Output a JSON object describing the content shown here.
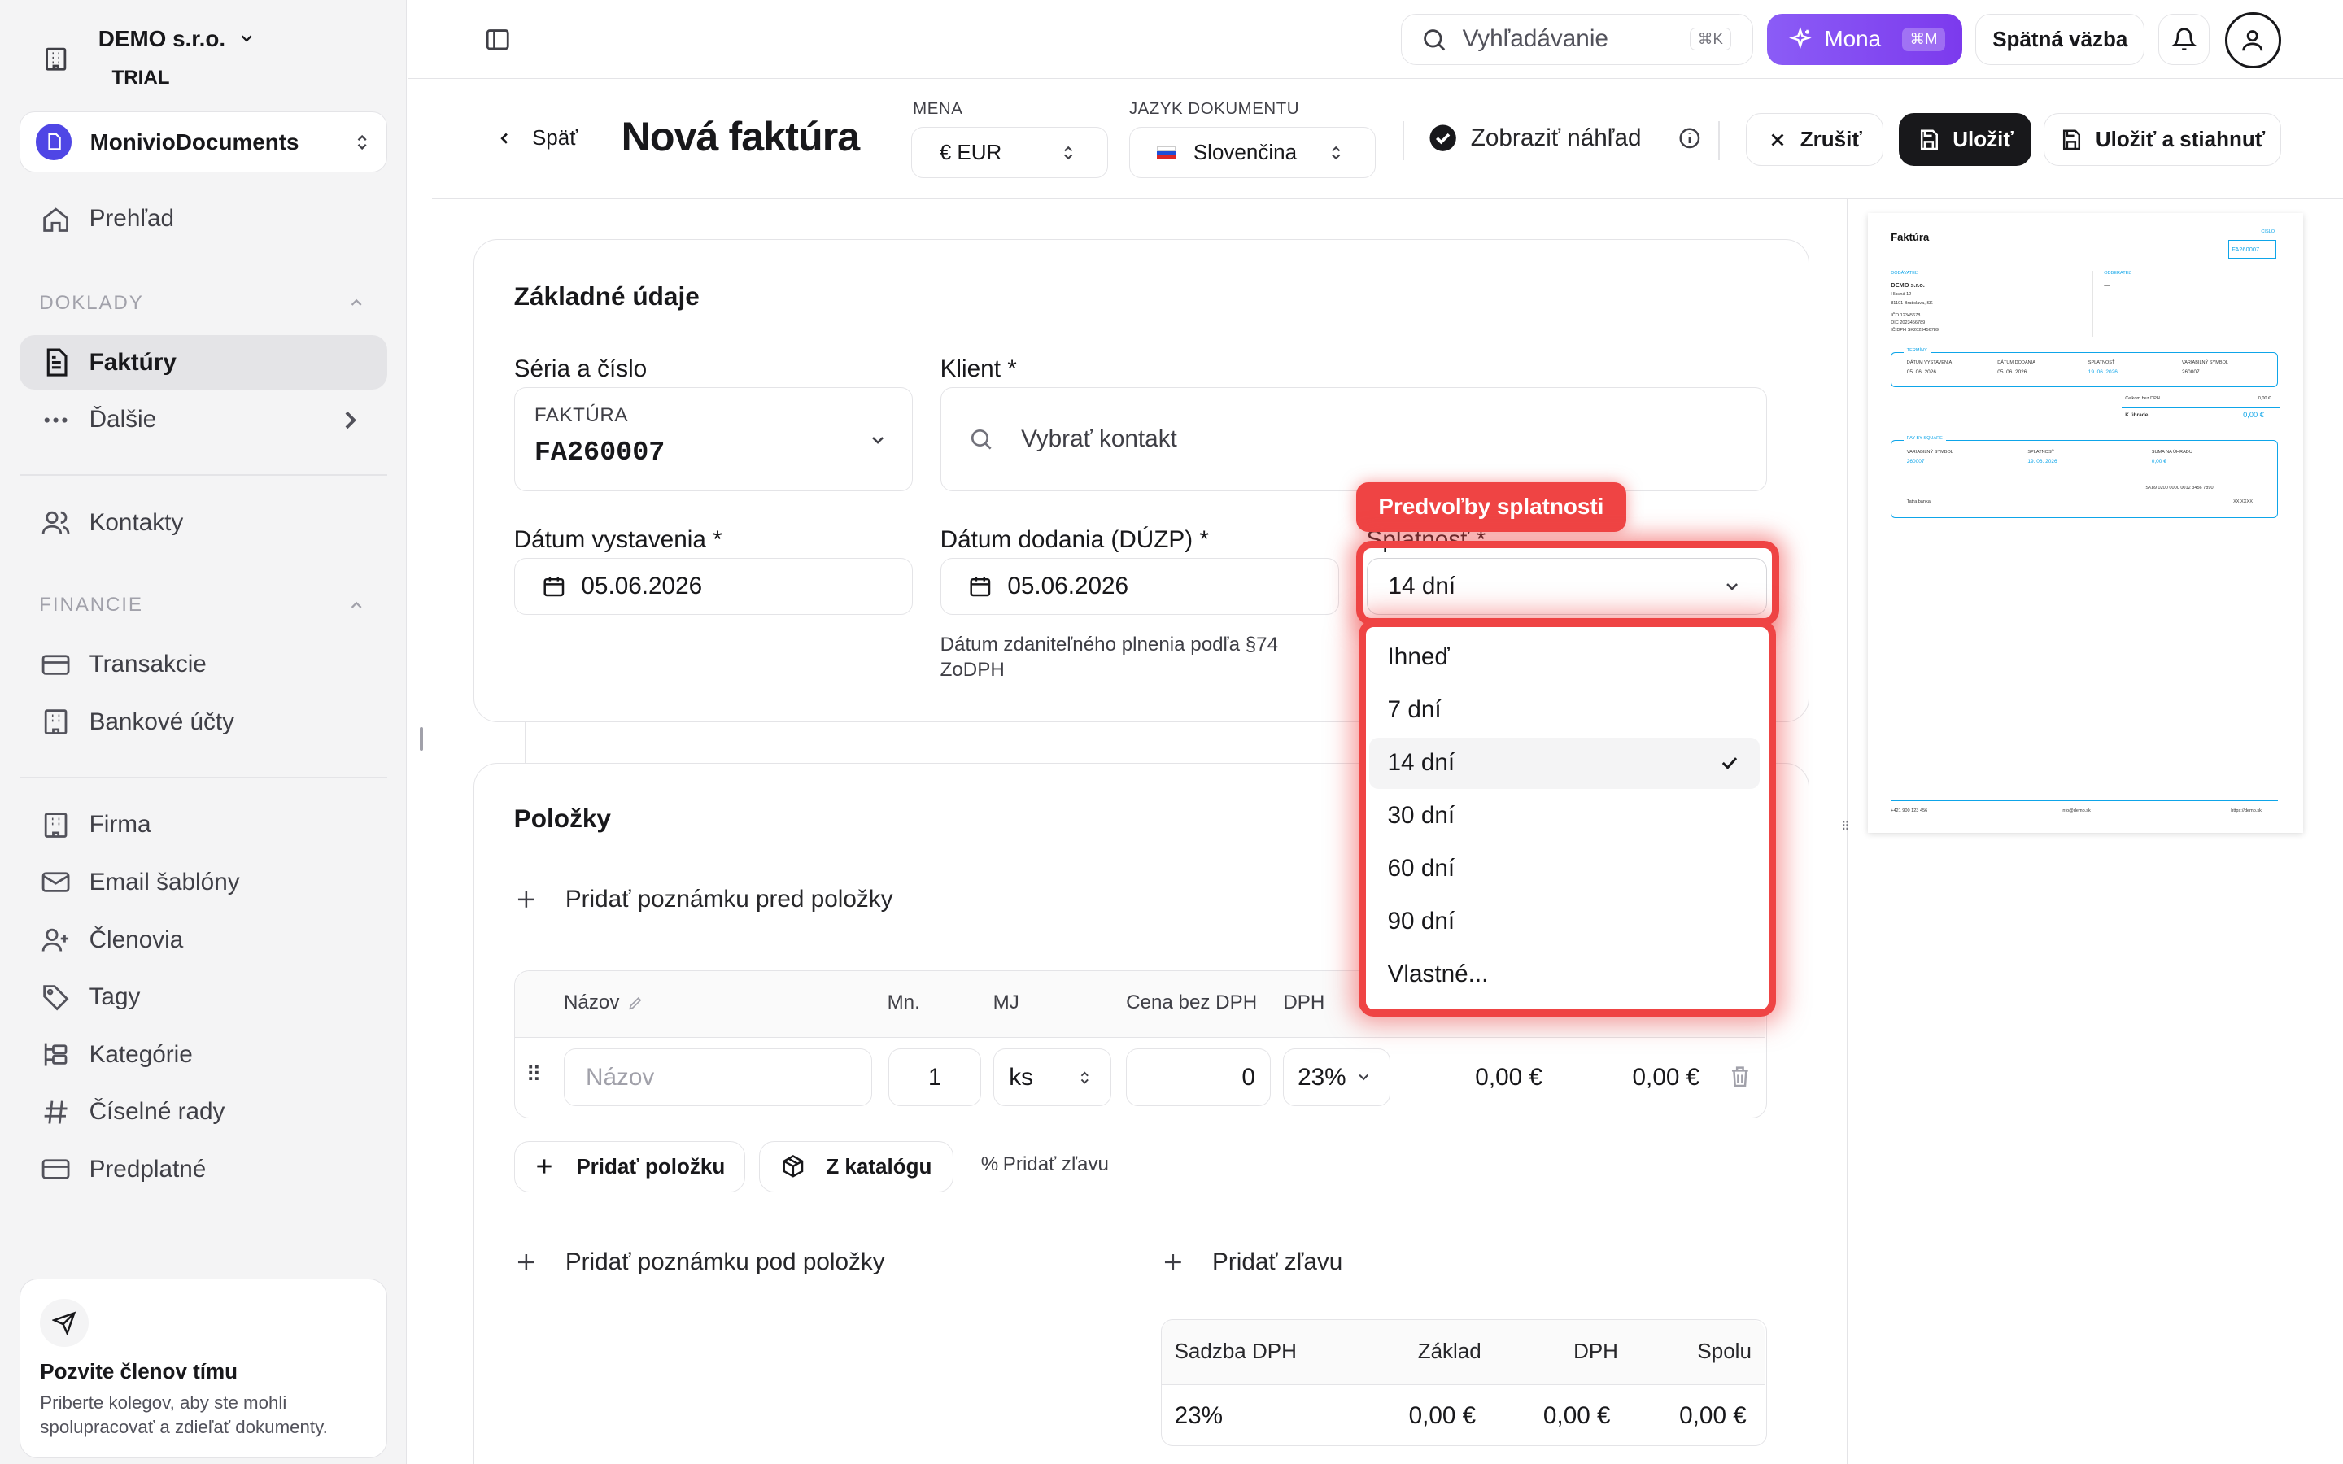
{
  "org": {
    "name": "DEMO s.r.o.",
    "plan": "TRIAL"
  },
  "workspace": {
    "name": "MonivioDocuments"
  },
  "sidebar": {
    "overview": "Prehľad",
    "section_documents": "DOKLADY",
    "invoices": "Faktúry",
    "more": "Ďalšie",
    "contacts": "Kontakty",
    "section_finance": "FINANCIE",
    "transactions": "Transakcie",
    "bank_accounts": "Bankové účty",
    "company": "Firma",
    "email_templates": "Email šablóny",
    "members": "Členovia",
    "tags": "Tagy",
    "categories": "Kategórie",
    "number_series": "Číselné rady",
    "subscription": "Predplatné",
    "invite": {
      "title": "Pozvite členov tímu",
      "text": "Priberte kolegov, aby ste mohli spolupracovať a zdieľať dokumenty."
    }
  },
  "topbar": {
    "search_placeholder": "Vyhľadávanie",
    "search_shortcut": "⌘K",
    "mona_label": "Mona",
    "mona_shortcut": "⌘M",
    "feedback_label": "Spätná väzba"
  },
  "header": {
    "back_label": "Späť",
    "title": "Nová faktúra",
    "currency_label": "MENA",
    "currency_value": "€ EUR",
    "language_label": "JAZYK DOKUMENTU",
    "language_value": "Slovenčina",
    "preview_toggle_label": "Zobraziť náhľad",
    "cancel_label": "Zrušiť",
    "save_label": "Uložiť",
    "save_download_label": "Uložiť a stiahnuť"
  },
  "basic": {
    "title": "Základné údaje",
    "series_label": "Séria a číslo",
    "series_prefix": "FAKTÚRA",
    "series_number": "FA260007",
    "client_label": "Klient *",
    "client_placeholder": "Vybrať kontakt",
    "issue_label": "Dátum vystavenia *",
    "issue_value": "05.06.2026",
    "delivery_label": "Dátum dodania (DÚZP) *",
    "delivery_value": "05.06.2026",
    "delivery_hint": "Dátum zdaniteľného plnenia podľa §74 ZoDPH",
    "due_label": "Splatnosť *",
    "due_value": "14 dní"
  },
  "dropdown": {
    "tooltip": "Predvoľby splatnosti",
    "options": [
      "Ihneď",
      "7 dní",
      "14 dní",
      "30 dní",
      "60 dní",
      "90 dní",
      "Vlastné..."
    ],
    "selected": "14 dní"
  },
  "items": {
    "title": "Položky",
    "add_note_before": "Pridať poznámku pred položky",
    "col_name": "Názov",
    "col_qty": "Mn.",
    "col_unit": "MJ",
    "col_price": "Cena bez DPH",
    "col_vat": "DPH",
    "row": {
      "name_placeholder": "Názov",
      "qty": "1",
      "unit": "ks",
      "price": "0",
      "vat": "23%",
      "total_net": "0,00 €",
      "total_gross": "0,00 €"
    },
    "add_item": "Pridať položku",
    "from_catalog": "Z katalógu",
    "add_discount_small": "Pridať zľavu",
    "add_note_after": "Pridať poznámku pod položky",
    "add_discount": "Pridať zľavu"
  },
  "vat_table": {
    "headers": [
      "Sadzba DPH",
      "Základ",
      "DPH",
      "Spolu"
    ],
    "row": [
      "23%",
      "0,00 €",
      "0,00 €",
      "0,00 €"
    ]
  },
  "preview": {
    "title": "Faktúra",
    "number_label": "ČÍSLO",
    "number": "FA260007",
    "supplier_label": "DODÁVATEĽ",
    "supplier_name": "DEMO s.r.o.",
    "supplier_street": "Hlavná 12",
    "supplier_city": "81101 Bratislava, SK",
    "supplier_ico": "IČO    12345678",
    "supplier_dic": "DIČ    2023456789",
    "supplier_icdph": "IČ DPH  SK2023456789",
    "customer_label": "ODBERATEĽ",
    "customer_value": "—",
    "terms_label": "TERMÍNY",
    "issue_label": "DÁTUM VYSTAVENIA",
    "issue": "05. 06. 2026",
    "delivery_label": "DÁTUM DODANIA",
    "delivery": "05. 06. 2026",
    "due_label": "SPLATNOSŤ",
    "due": "19. 06. 2026",
    "vs_label": "VARIABILNÝ SYMBOL",
    "vs": "260007",
    "total_net_label": "Celkom bez DPH",
    "total_net": "0,00 €",
    "to_pay_label": "K úhrade",
    "to_pay": "0,00 €",
    "pay_label": "PAY BY SQUARE",
    "pay_vs_label": "VARIABILNÝ SYMBOL",
    "pay_vs": "260007",
    "pay_due_label": "SPLATNOSŤ",
    "pay_due": "19. 06. 2026",
    "pay_sum_label": "SUMA NA ÚHRADU",
    "pay_sum": "0,00 €",
    "iban": "SK89 0200 0000 0012 3456 7890",
    "bank": "Tatra banka",
    "swift": "XX XXXX",
    "phone": "+421 900 123 456",
    "email": "info@demo.sk",
    "web": "https://demo.sk"
  },
  "colors": {
    "accent": "#7c3aed",
    "danger": "#ef4444",
    "preview_accent": "#0ea5e9"
  }
}
